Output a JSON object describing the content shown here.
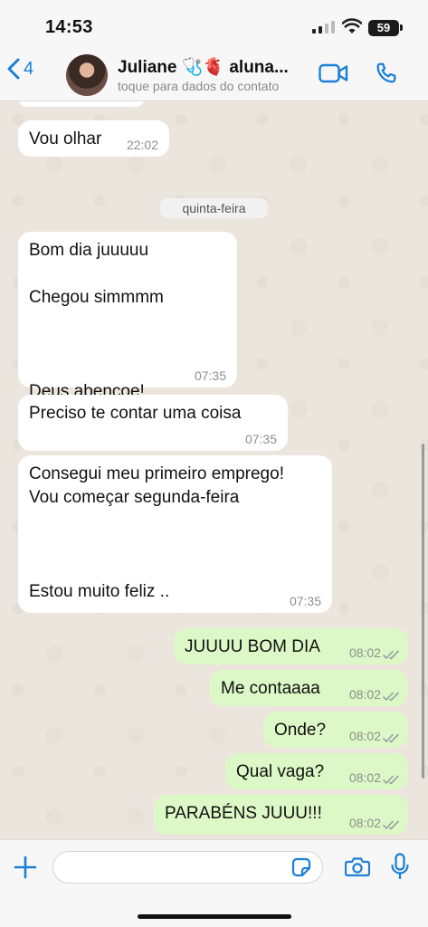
{
  "status_bar": {
    "time": "14:53",
    "battery": "59"
  },
  "header": {
    "back_count": "4",
    "contact_name": "Juliane 🩺🫀 aluna...",
    "contact_subtitle": "toque para dados do contato"
  },
  "chat": {
    "date_separator": "quinta-feira",
    "messages": [
      {
        "direction": "in",
        "text": "Vou olhar",
        "time": "22:02"
      },
      {
        "direction": "in",
        "text": "Bom dia juuuuu\n\nChegou simmmm\n\n\n\nDeus abençoe!",
        "time": "07:35"
      },
      {
        "direction": "in",
        "text": "Preciso te contar uma coisa",
        "time": "07:35"
      },
      {
        "direction": "in",
        "text": "Consegui meu primeiro emprego!\nVou começar segunda-feira\n\n\n\nEstou muito feliz ..",
        "time": "07:35"
      },
      {
        "direction": "out",
        "text": "JUUUU BOM DIA",
        "time": "08:02",
        "status": "read"
      },
      {
        "direction": "out",
        "text": "Me contaaaa",
        "time": "08:02",
        "status": "read"
      },
      {
        "direction": "out",
        "text": "Onde?",
        "time": "08:02",
        "status": "read"
      },
      {
        "direction": "out",
        "text": "Qual vaga?",
        "time": "08:02",
        "status": "read"
      },
      {
        "direction": "out",
        "text": "PARABÉNS JUUU!!!",
        "time": "08:02",
        "status": "read"
      }
    ]
  },
  "input": {
    "placeholder": "",
    "value": ""
  },
  "icons": {
    "back": "chevron-left-icon",
    "video_call": "video-camera-icon",
    "voice_call": "phone-icon",
    "attach": "plus-icon",
    "sticker": "sticker-icon",
    "camera": "camera-icon",
    "microphone": "microphone-icon",
    "read_receipt": "double-check-icon"
  },
  "colors": {
    "accent": "#1b7fd8",
    "incoming_bubble": "#ffffff",
    "outgoing_bubble": "#dcf8c6",
    "chat_background": "#ece5dd"
  }
}
